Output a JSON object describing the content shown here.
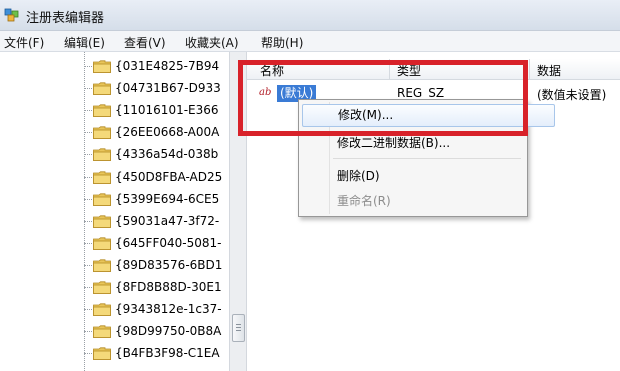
{
  "window": {
    "title": "注册表编辑器",
    "icon": "regedit-icon"
  },
  "menubar": {
    "items": [
      "文件(F)",
      "编辑(E)",
      "查看(V)",
      "收藏夹(A)",
      "帮助(H)"
    ]
  },
  "tree": {
    "items": [
      "{031E4825-7B94",
      "{04731B67-D933",
      "{11016101-E366",
      "{26EE0668-A00A",
      "{4336a54d-038b",
      "{450D8FBA-AD25",
      "{5399E694-6CE5",
      "{59031a47-3f72-",
      "{645FF040-5081-",
      "{89D83576-6BD1",
      "{8FD8B88D-30E1",
      "{9343812e-1c37-",
      "{98D99750-0B8A",
      "{B4FB3F98-C1EA"
    ]
  },
  "list": {
    "columns": [
      "名称",
      "类型",
      "数据"
    ],
    "rows": [
      {
        "icon": "ab",
        "name": "(默认)",
        "type": "REG_SZ",
        "data": "(数值未设置)"
      }
    ]
  },
  "context_menu": {
    "modify": "修改(M)...",
    "modify_binary": "修改二进制数据(B)...",
    "delete": "删除(D)",
    "rename": "重命名(R)"
  },
  "colors": {
    "highlight_border": "#d8222a",
    "selection": "#3a7bd5",
    "folder": "#e8c55a"
  }
}
